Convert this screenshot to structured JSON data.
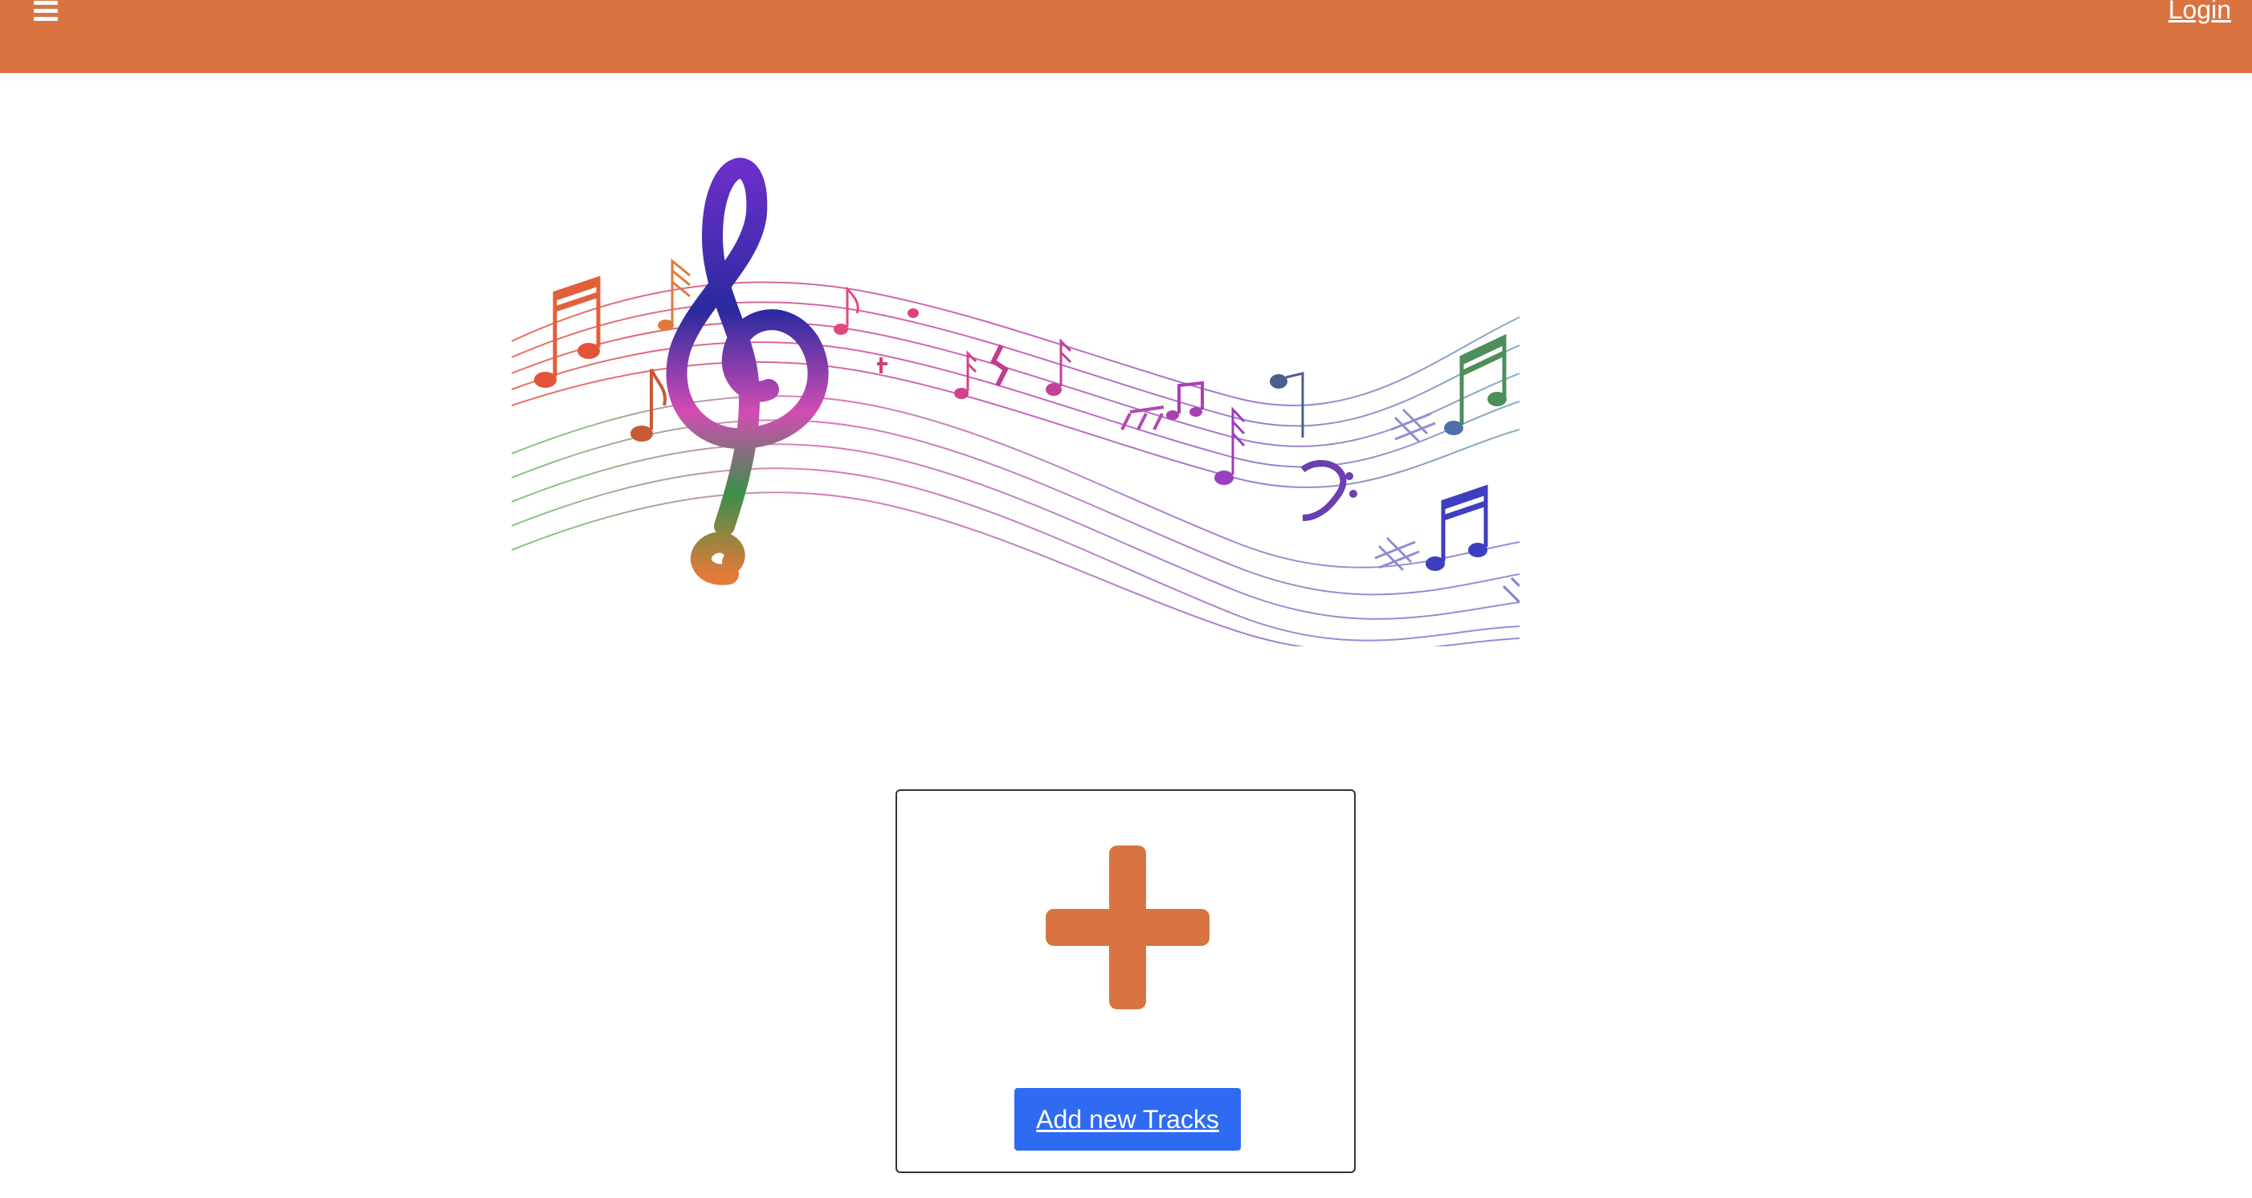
{
  "header": {
    "menu_icon": "hamburger-menu-icon",
    "login_label": "Login",
    "background_color": "#D97441"
  },
  "hero": {
    "image_description_icon": "music-notes-staff-illustration"
  },
  "add_card": {
    "icon": "plus-icon",
    "button_label": "Add new Tracks",
    "accent_color": "#D97441",
    "button_color": "#2F6BF2"
  }
}
